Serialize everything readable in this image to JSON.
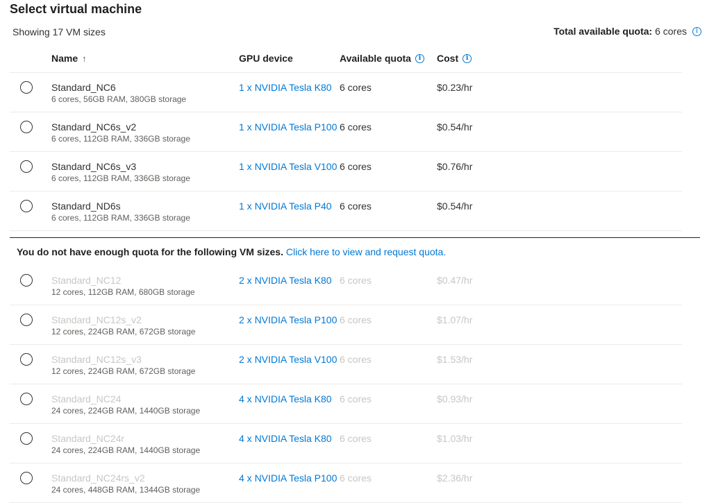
{
  "page": {
    "title": "Select virtual machine",
    "showing": "Showing 17 VM sizes",
    "quota_label": "Total available quota:",
    "quota_value": "6 cores"
  },
  "columns": {
    "name": "Name",
    "sort_indicator": "↑",
    "gpu": "GPU device",
    "quota": "Available quota",
    "cost": "Cost"
  },
  "available_vms": [
    {
      "name": "Standard_NC6",
      "spec": "6 cores, 56GB RAM, 380GB storage",
      "gpu": "1 x NVIDIA Tesla K80",
      "quota": "6 cores",
      "cost": "$0.23/hr"
    },
    {
      "name": "Standard_NC6s_v2",
      "spec": "6 cores, 112GB RAM, 336GB storage",
      "gpu": "1 x NVIDIA Tesla P100...",
      "quota": "6 cores",
      "cost": "$0.54/hr"
    },
    {
      "name": "Standard_NC6s_v3",
      "spec": "6 cores, 112GB RAM, 336GB storage",
      "gpu": "1 x NVIDIA Tesla V100...",
      "quota": "6 cores",
      "cost": "$0.76/hr"
    },
    {
      "name": "Standard_ND6s",
      "spec": "6 cores, 112GB RAM, 336GB storage",
      "gpu": "1 x NVIDIA Tesla P40",
      "quota": "6 cores",
      "cost": "$0.54/hr"
    }
  ],
  "notice": {
    "text": "You do not have enough quota for the following VM sizes.",
    "link": "Click here to view and request quota."
  },
  "unavailable_vms": [
    {
      "name": "Standard_NC12",
      "spec": "12 cores, 112GB RAM, 680GB storage",
      "gpu": "2 x NVIDIA Tesla K80",
      "quota": "6 cores",
      "cost": "$0.47/hr"
    },
    {
      "name": "Standard_NC12s_v2",
      "spec": "12 cores, 224GB RAM, 672GB storage",
      "gpu": "2 x NVIDIA Tesla P100...",
      "quota": "6 cores",
      "cost": "$1.07/hr"
    },
    {
      "name": "Standard_NC12s_v3",
      "spec": "12 cores, 224GB RAM, 672GB storage",
      "gpu": "2 x NVIDIA Tesla V100...",
      "quota": "6 cores",
      "cost": "$1.53/hr"
    },
    {
      "name": "Standard_NC24",
      "spec": "24 cores, 224GB RAM, 1440GB storage",
      "gpu": "4 x NVIDIA Tesla K80",
      "quota": "6 cores",
      "cost": "$0.93/hr"
    },
    {
      "name": "Standard_NC24r",
      "spec": "24 cores, 224GB RAM, 1440GB storage",
      "gpu": "4 x NVIDIA Tesla K80",
      "quota": "6 cores",
      "cost": "$1.03/hr"
    },
    {
      "name": "Standard_NC24rs_v2",
      "spec": "24 cores, 448GB RAM, 1344GB storage",
      "gpu": "4 x NVIDIA Tesla P100...",
      "quota": "6 cores",
      "cost": "$2.36/hr"
    }
  ],
  "icons": {
    "info": "info-icon",
    "radio": "radio-unselected"
  },
  "colors": {
    "link": "#0078d4",
    "disabled_text": "#c8c6c4",
    "divider": "#edebe9"
  }
}
